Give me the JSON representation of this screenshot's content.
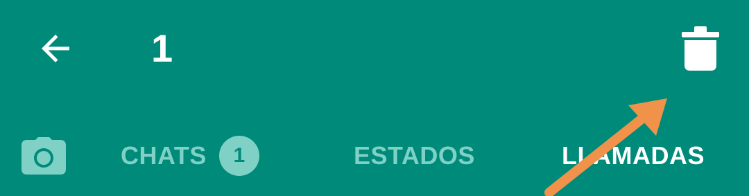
{
  "toolbar": {
    "back_icon": "arrow-left-icon",
    "selection_count": "1",
    "delete_icon": "trash-icon"
  },
  "tabs": {
    "camera": {
      "icon": "camera-icon"
    },
    "chats": {
      "label": "CHATS",
      "badge": "1"
    },
    "estados": {
      "label": "ESTADOS"
    },
    "llamadas": {
      "label": "LLAMADAS",
      "active": true
    }
  },
  "annotation": {
    "type": "pointer-arrow",
    "color": "#f0924a",
    "points_to": "delete-button"
  },
  "colors": {
    "background": "#008a7a",
    "active_text": "#ffffff",
    "inactive_text": "#7fd1c6",
    "arrow": "#f0924a"
  }
}
